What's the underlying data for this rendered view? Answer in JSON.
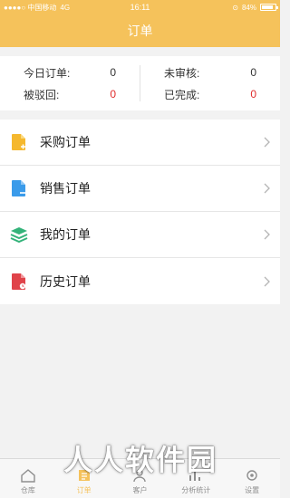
{
  "status_bar": {
    "carrier": "●●●●○ 中国移动",
    "network": "4G",
    "time": "16:11",
    "battery": "84%"
  },
  "nav": {
    "title": "订单"
  },
  "summary": {
    "today_orders": {
      "label": "今日订单:",
      "value": "0"
    },
    "rejected": {
      "label": "被驳回:",
      "value": "0"
    },
    "unreviewed": {
      "label": "未审核:",
      "value": "0"
    },
    "completed": {
      "label": "已完成:",
      "value": "0"
    }
  },
  "menu": [
    {
      "label": "采购订单",
      "icon": "purchase-doc-icon",
      "color": "#f5b82e"
    },
    {
      "label": "销售订单",
      "icon": "sales-doc-icon",
      "color": "#3a9bea"
    },
    {
      "label": "我的订单",
      "icon": "stack-layers-icon",
      "color": "#34b37a"
    },
    {
      "label": "历史订单",
      "icon": "history-doc-icon",
      "color": "#e0434a"
    }
  ],
  "tabs": [
    {
      "label": "仓库",
      "icon": "home-icon"
    },
    {
      "label": "订单",
      "icon": "order-icon",
      "active": true
    },
    {
      "label": "客户",
      "icon": "customer-icon"
    },
    {
      "label": "分析统计",
      "icon": "analytics-icon"
    },
    {
      "label": "设置",
      "icon": "settings-icon"
    }
  ],
  "watermark": "人人软件园",
  "colors": {
    "accent": "#f5c25b",
    "red_value": "#e02d2d"
  }
}
